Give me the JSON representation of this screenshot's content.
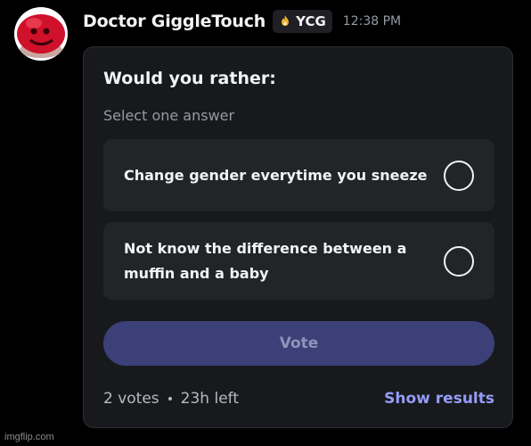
{
  "message": {
    "author": "Doctor GiggleTouch",
    "tag": {
      "icon": "flame-badge-icon",
      "label": "YCG",
      "color": "#f0b232"
    },
    "timestamp": "12:38 PM",
    "avatar": "red-blob-face-avatar"
  },
  "poll": {
    "question": "Would you rather:",
    "subtitle": "Select one answer",
    "answers": [
      {
        "label": "Change gender everytime you sneeze",
        "selected": false
      },
      {
        "label": "Not know the difference between a muffin and a baby",
        "selected": false
      }
    ],
    "vote_label": "Vote",
    "votes": "2 votes",
    "time_left": "23h left",
    "show_results_label": "Show results"
  },
  "watermark": "imgflip.com",
  "colors": {
    "background": "#000000",
    "card": "#18191c",
    "answer_bg": "#232428",
    "vote_button": "#3b4078",
    "link": "#949cf7",
    "muted": "#949ba4"
  }
}
